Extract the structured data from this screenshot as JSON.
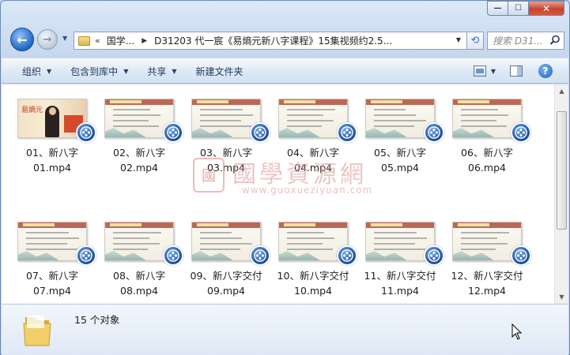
{
  "window": {
    "minimize_label": "—",
    "maximize_label": "☐",
    "close_label": "✕"
  },
  "nav": {
    "back_icon": "←",
    "forward_icon": "→",
    "address": {
      "overflow": "«",
      "segment1": "国学...",
      "segment2": "D31203 代一宸《易熵元新八字课程》15集视频约2.5..."
    },
    "search_placeholder": "搜索 D31..."
  },
  "toolbar": {
    "organize": "组织",
    "include_library": "包含到库中",
    "share": "共享",
    "new_folder": "新建文件夹"
  },
  "files": [
    {
      "label": "01、新八字\n01.mp4",
      "thumb": "photo"
    },
    {
      "label": "02、新八字\n02.mp4",
      "thumb": "slide"
    },
    {
      "label": "03、新八字\n03.mp4",
      "thumb": "slide"
    },
    {
      "label": "04、新八字\n04.mp4",
      "thumb": "slide"
    },
    {
      "label": "05、新八字\n05.mp4",
      "thumb": "slide"
    },
    {
      "label": "06、新八字\n06.mp4",
      "thumb": "slide"
    },
    {
      "label": "07、新八字\n07.mp4",
      "thumb": "slide"
    },
    {
      "label": "08、新八字\n08.mp4",
      "thumb": "slide"
    },
    {
      "label": "09、新八字交付\n09.mp4",
      "thumb": "slide"
    },
    {
      "label": "10、新八字交付\n10.mp4",
      "thumb": "slide"
    },
    {
      "label": "11、新八字交付\n11.mp4",
      "thumb": "slide"
    },
    {
      "label": "12、新八字交付\n12.mp4",
      "thumb": "slide"
    }
  ],
  "thumb_photo_text": "易熵元",
  "watermark": {
    "seal": "國",
    "title": "國學資源網",
    "url": "www.guoxueziyuan.com"
  },
  "status": {
    "count": "15 个对象"
  },
  "colors": {
    "accent": "#1f66c6",
    "close": "#c7442f"
  }
}
